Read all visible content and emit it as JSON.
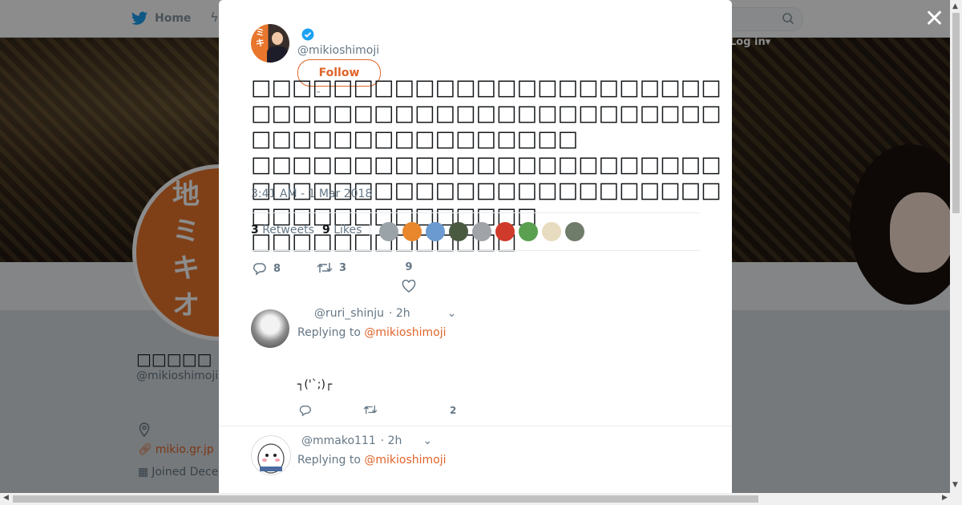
{
  "topbar": {
    "home_label": "Home",
    "login_label": "Log in"
  },
  "profile": {
    "name": "□□□□□",
    "handle": "@mikioshimoji",
    "website": "mikio.gr.jp",
    "joined": "Joined Dece",
    "avatar_text": "地ミキオ"
  },
  "tweet": {
    "handle": "@mikioshimoji",
    "follow_label": "Follow",
    "text": "□□□□□□□□□□□□□□□□□□□□□□□□□□□□□□□□□□□□□□□□□□□□□□□□□□□□□□□□□□□□□□\n□□□□□□□□□□□□□□□□□□□□□□□□□□□□□□□□□□□□□□□□□□□□□□□□□□□□□□□□□□□□\n□□□□□□□□□□□□□",
    "timestamp": "3:41 AM - 1 Mar 2018",
    "retweets_count": "3",
    "retweets_label": "Retweets",
    "likes_count": "9",
    "likes_label": "Likes",
    "reply_count": "8",
    "retweet_action_count": "3",
    "like_action_count": "9",
    "likers_colors": [
      "#9aa3a8",
      "#e8872c",
      "#6a9ad0",
      "#4a5a40",
      "#a0a4a8",
      "#d03a2a",
      "#5aa050",
      "#e8dcc0",
      "#707c6a"
    ]
  },
  "replies": [
    {
      "handle": "@ruri_shinju",
      "time": "· 2h",
      "replying_prefix": "Replying to",
      "replying_to": "@mikioshimoji",
      "body": "┐('`;)┌",
      "like_count": "2"
    },
    {
      "handle": "@mmako111",
      "time": "· 2h",
      "replying_prefix": "Replying to",
      "replying_to": "@mikioshimoji"
    }
  ],
  "colors": {
    "accent": "#e0642a",
    "verified": "#1da1f2",
    "muted": "#657786"
  }
}
